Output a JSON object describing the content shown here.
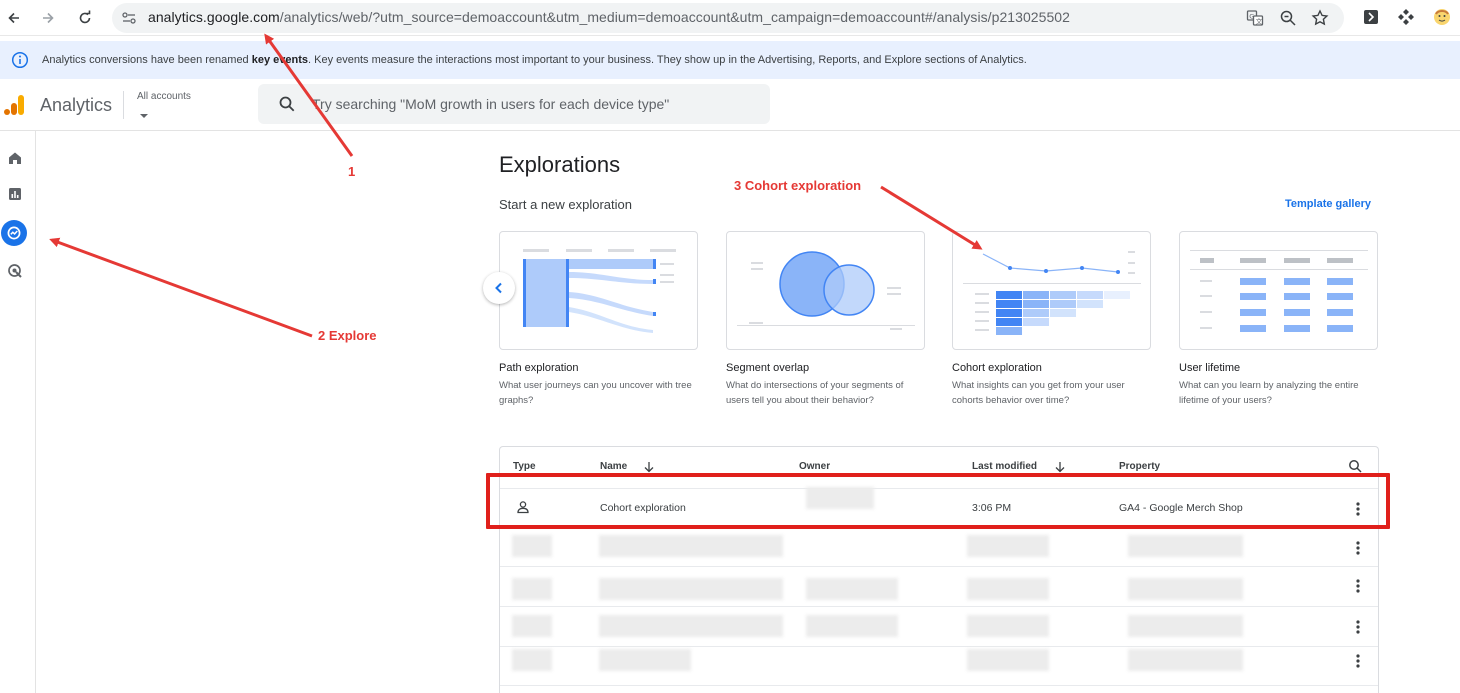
{
  "browser": {
    "url_host": "analytics.google.com",
    "url_path": "/analytics/web/?utm_source=demoaccount&utm_medium=demoaccount&utm_campaign=demoaccount#/analysis/p213025502"
  },
  "banner": {
    "text_before": "Analytics conversions have been renamed ",
    "text_bold": "key events",
    "text_after": ". Key events measure the interactions most important to your business. They show up in the Advertising, Reports, and Explore sections of Analytics."
  },
  "header": {
    "app_title": "Analytics",
    "accounts_label": "All accounts",
    "search_placeholder": "Try searching \"MoM growth in users for each device type\""
  },
  "sidebar": {
    "items": [
      {
        "name": "home",
        "icon": "home-icon",
        "active": false
      },
      {
        "name": "reports",
        "icon": "bar-chart-icon",
        "active": false
      },
      {
        "name": "explore",
        "icon": "explore-icon",
        "active": true
      },
      {
        "name": "advertising",
        "icon": "advertising-icon",
        "active": false
      }
    ]
  },
  "main": {
    "title": "Explorations",
    "subtitle": "Start a new exploration",
    "template_gallery": "Template gallery",
    "cards": [
      {
        "title": "Path exploration",
        "desc": "What user journeys can you uncover with tree graphs?"
      },
      {
        "title": "Segment overlap",
        "desc": "What do intersections of your segments of users tell you about their behavior?"
      },
      {
        "title": "Cohort exploration",
        "desc": "What insights can you get from your user cohorts behavior over time?"
      },
      {
        "title": "User lifetime",
        "desc": "What can you learn by analyzing the entire lifetime of your users?"
      }
    ]
  },
  "table": {
    "columns": {
      "type": "Type",
      "name": "Name",
      "owner": "Owner",
      "last_modified": "Last modified",
      "property": "Property"
    },
    "rows": [
      {
        "type_icon": "person-icon",
        "name": "Cohort exploration",
        "owner": "",
        "last_modified": "3:06 PM",
        "property": "GA4 - Google Merch Shop"
      }
    ]
  },
  "annotations": {
    "label_1": "1",
    "label_2": "2 Explore",
    "label_3": "3 Cohort exploration",
    "color": "#e53935"
  }
}
